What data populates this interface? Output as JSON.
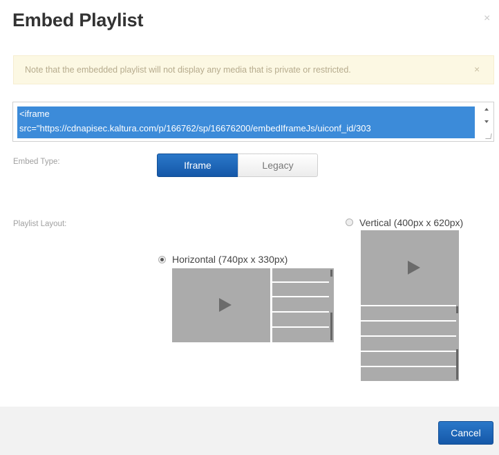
{
  "dialog": {
    "title": "Embed Playlist",
    "close_glyph": "×"
  },
  "alert": {
    "text": "Note that the embedded playlist will not display any media that is private or restricted.",
    "close_glyph": "×"
  },
  "embed_code": {
    "line1": "<iframe",
    "line2": "src=\"https://cdnapisec.kaltura.com/p/166762/sp/16676200/embedIframeJs/uiconf_id/303"
  },
  "embed_type": {
    "label": "Embed Type:",
    "options": [
      "Iframe",
      "Legacy"
    ],
    "selected": "Iframe"
  },
  "playlist_layout": {
    "label": "Playlist Layout:",
    "horizontal_label": "Horizontal (740px x 330px)",
    "vertical_label": "Vertical (400px x 620px)",
    "selected": "Horizontal (740px x 330px)"
  },
  "footer": {
    "cancel_label": "Cancel"
  },
  "colors": {
    "primary": "#1f6bbf",
    "selection": "#3c8bd9",
    "alert_bg": "#fcf8e3",
    "preview_gray": "#ababab"
  },
  "icons": [
    "close-icon",
    "alert-close-icon",
    "play-icon",
    "radio-icon"
  ]
}
